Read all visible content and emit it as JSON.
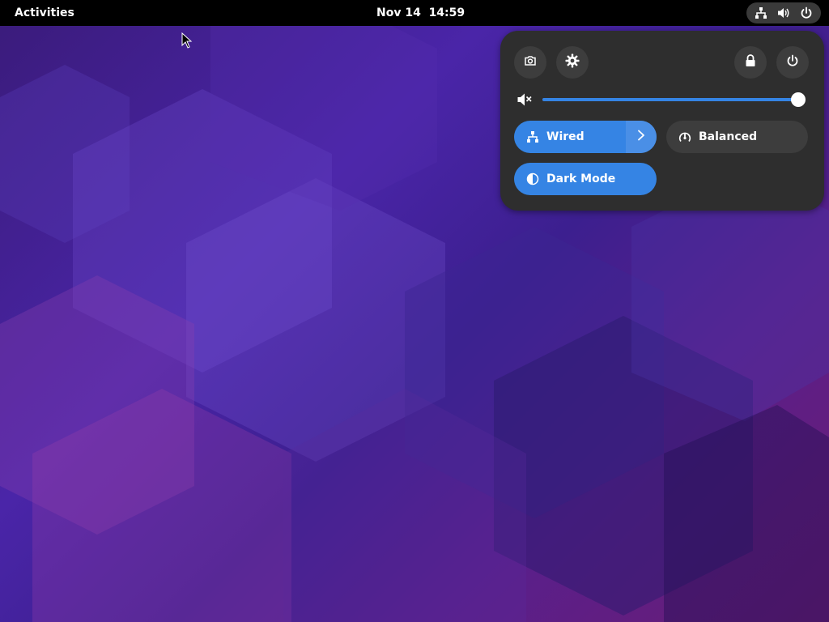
{
  "topbar": {
    "activities_label": "Activities",
    "clock": "Nov 14  14:59",
    "status_icons": [
      "network-wired-icon",
      "volume-icon",
      "power-icon"
    ]
  },
  "quick_settings": {
    "top_buttons": [
      "screenshot-icon",
      "settings-icon",
      "lock-icon",
      "power-icon"
    ],
    "volume": {
      "muted_icon": "audio-muted-icon",
      "level": 1.0
    },
    "toggles": {
      "wired": {
        "label": "Wired",
        "active": true,
        "icon": "network-wired-icon"
      },
      "power_mode": {
        "label": "Balanced",
        "active": false,
        "icon": "power-profile-icon"
      },
      "dark_mode": {
        "label": "Dark Mode",
        "active": true,
        "icon": "dark-mode-icon"
      }
    }
  },
  "colors": {
    "accent": "#3584e4",
    "panel": "#2e2e2e",
    "button": "#3d3d3d",
    "topbar": "#000000"
  }
}
